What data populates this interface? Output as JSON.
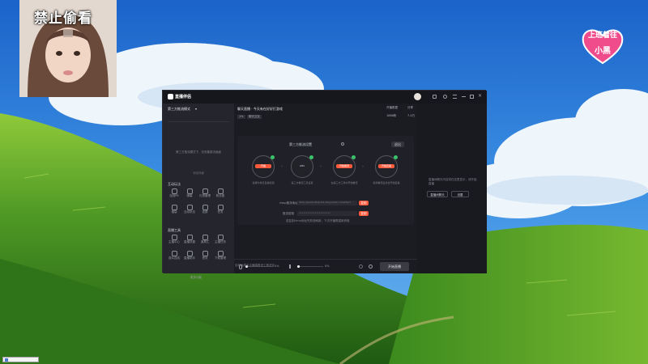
{
  "overlay": {
    "webcam_caption": "禁止偷看",
    "sticker_line1": "上班着往",
    "sticker_line2": "小黑"
  },
  "app": {
    "logo_text": "直播伴侣",
    "room_title": "聊天直播 · 今天有在好好打游戏",
    "header_meta_1": "开播数据",
    "header_meta_2": "分享",
    "header_meta_3": "1866粉",
    "header_meta_4": "7.4万",
    "tag_1": "1%",
    "tag_2": "聊天交友"
  },
  "sidebar": {
    "mode_label": "第三方推流模式",
    "empty_hint": "第三方推流模式下，仅采集推流画面",
    "add_hint": "添加场景",
    "section_interact": "互动玩法",
    "section_tools": "直播工具",
    "more_label": "更多功能",
    "interact_tools": [
      "连线PK",
      "弹幕",
      "礼物管理",
      "粉丝团",
      "福袋",
      "互动玩法",
      "连屏",
      "任务"
    ],
    "live_tools": [
      "主播中心",
      "直播设置",
      "道具栏",
      "主播任务",
      "观众连线",
      "直播助手",
      "音效",
      "下载管理"
    ]
  },
  "stream_setup": {
    "title": "第三方推流设置",
    "exit_label": "退出",
    "steps": [
      {
        "icon_label": "开播",
        "caption": "选择分类及直播标题"
      },
      {
        "icon_label": "OBS",
        "caption": "第三方推流工具设置"
      },
      {
        "icon_label": "开始推流",
        "caption": "在第三方工具中开始推流"
      },
      {
        "icon_label": "开始直播",
        "caption": "检测推流后点击开始直播"
      }
    ],
    "rtmp_label": "rtmp推流地址",
    "rtmp_value": "rtmp://push-rtmp-l11.douyincdn.com/third",
    "key_label": "推流密钥",
    "key_value": "••••••••••••••••••••••",
    "copy_label": "复制",
    "hint": "若复制rtmp地址失败请刷新，下次开播需重新获取"
  },
  "bottom_bar": {
    "mic_pct": "0%",
    "speaker_pct": "0%",
    "start_button": "开始直播",
    "footer": "实时画质由主播端推流工具决定"
  },
  "right_panel": {
    "message": "直播间聊天内容将在这里显示，请开始直播",
    "btn_1": "直播间聊天",
    "btn_2": "设置"
  },
  "colors": {
    "accent": "#ff5a3c",
    "status_ok": "#39c26a",
    "window_bg": "#1b1c22",
    "sidebar_bg": "#24252d"
  }
}
